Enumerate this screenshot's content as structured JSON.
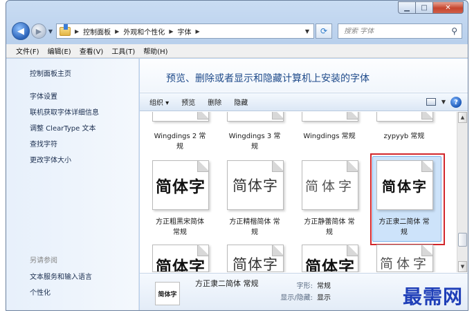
{
  "window": {
    "caption": {
      "minimize": "▁",
      "maximize": "□",
      "close": "✕"
    }
  },
  "address": {
    "breadcrumbs": [
      "控制面板",
      "外观和个性化",
      "字体"
    ],
    "search_placeholder": "搜索 字体"
  },
  "menu": [
    "文件(F)",
    "编辑(E)",
    "查看(V)",
    "工具(T)",
    "帮助(H)"
  ],
  "sidebar": {
    "home": "控制面板主页",
    "links": [
      "字体设置",
      "联机获取字体详细信息",
      "调整 ClearType 文本",
      "查找字符",
      "更改字体大小"
    ],
    "see_also_title": "另请参阅",
    "see_also": [
      "文本服务和输入语言",
      "个性化"
    ]
  },
  "main": {
    "title": "预览、删除或者显示和隐藏计算机上安装的字体"
  },
  "toolbar": {
    "organize": "组织 ▾",
    "preview": "预览",
    "delete": "删除",
    "hide": "隐藏",
    "help": "?"
  },
  "fonts": {
    "row1": [
      {
        "name1": "Wingdings 2 常",
        "name2": "规"
      },
      {
        "name1": "Wingdings 3 常",
        "name2": "规"
      },
      {
        "name1": "Wingdings 常规",
        "name2": ""
      },
      {
        "name1": "zypyyb 常规",
        "name2": ""
      }
    ],
    "row2": [
      {
        "sample": "简体字",
        "name1": "方正粗黑宋简体",
        "name2": "常规"
      },
      {
        "sample": "简体字",
        "name1": "方正精楷简体 常",
        "name2": "规"
      },
      {
        "sample": "简体字",
        "name1": "方正静蕾简体 常",
        "name2": "规"
      },
      {
        "sample": "简体字",
        "name1": "方正隶二简体 常",
        "name2": "规"
      }
    ],
    "row3": [
      {
        "sample": "简体字"
      },
      {
        "sample": "简体字"
      },
      {
        "sample": "简体字"
      },
      {
        "sample": "简体字"
      }
    ]
  },
  "details": {
    "thumb": "简体字",
    "name": "方正隶二简体 常规",
    "style_label": "字形:",
    "style_value": "常规",
    "visibility_label": "显示/隐藏:",
    "visibility_value": "显示"
  },
  "watermark": "最需网"
}
